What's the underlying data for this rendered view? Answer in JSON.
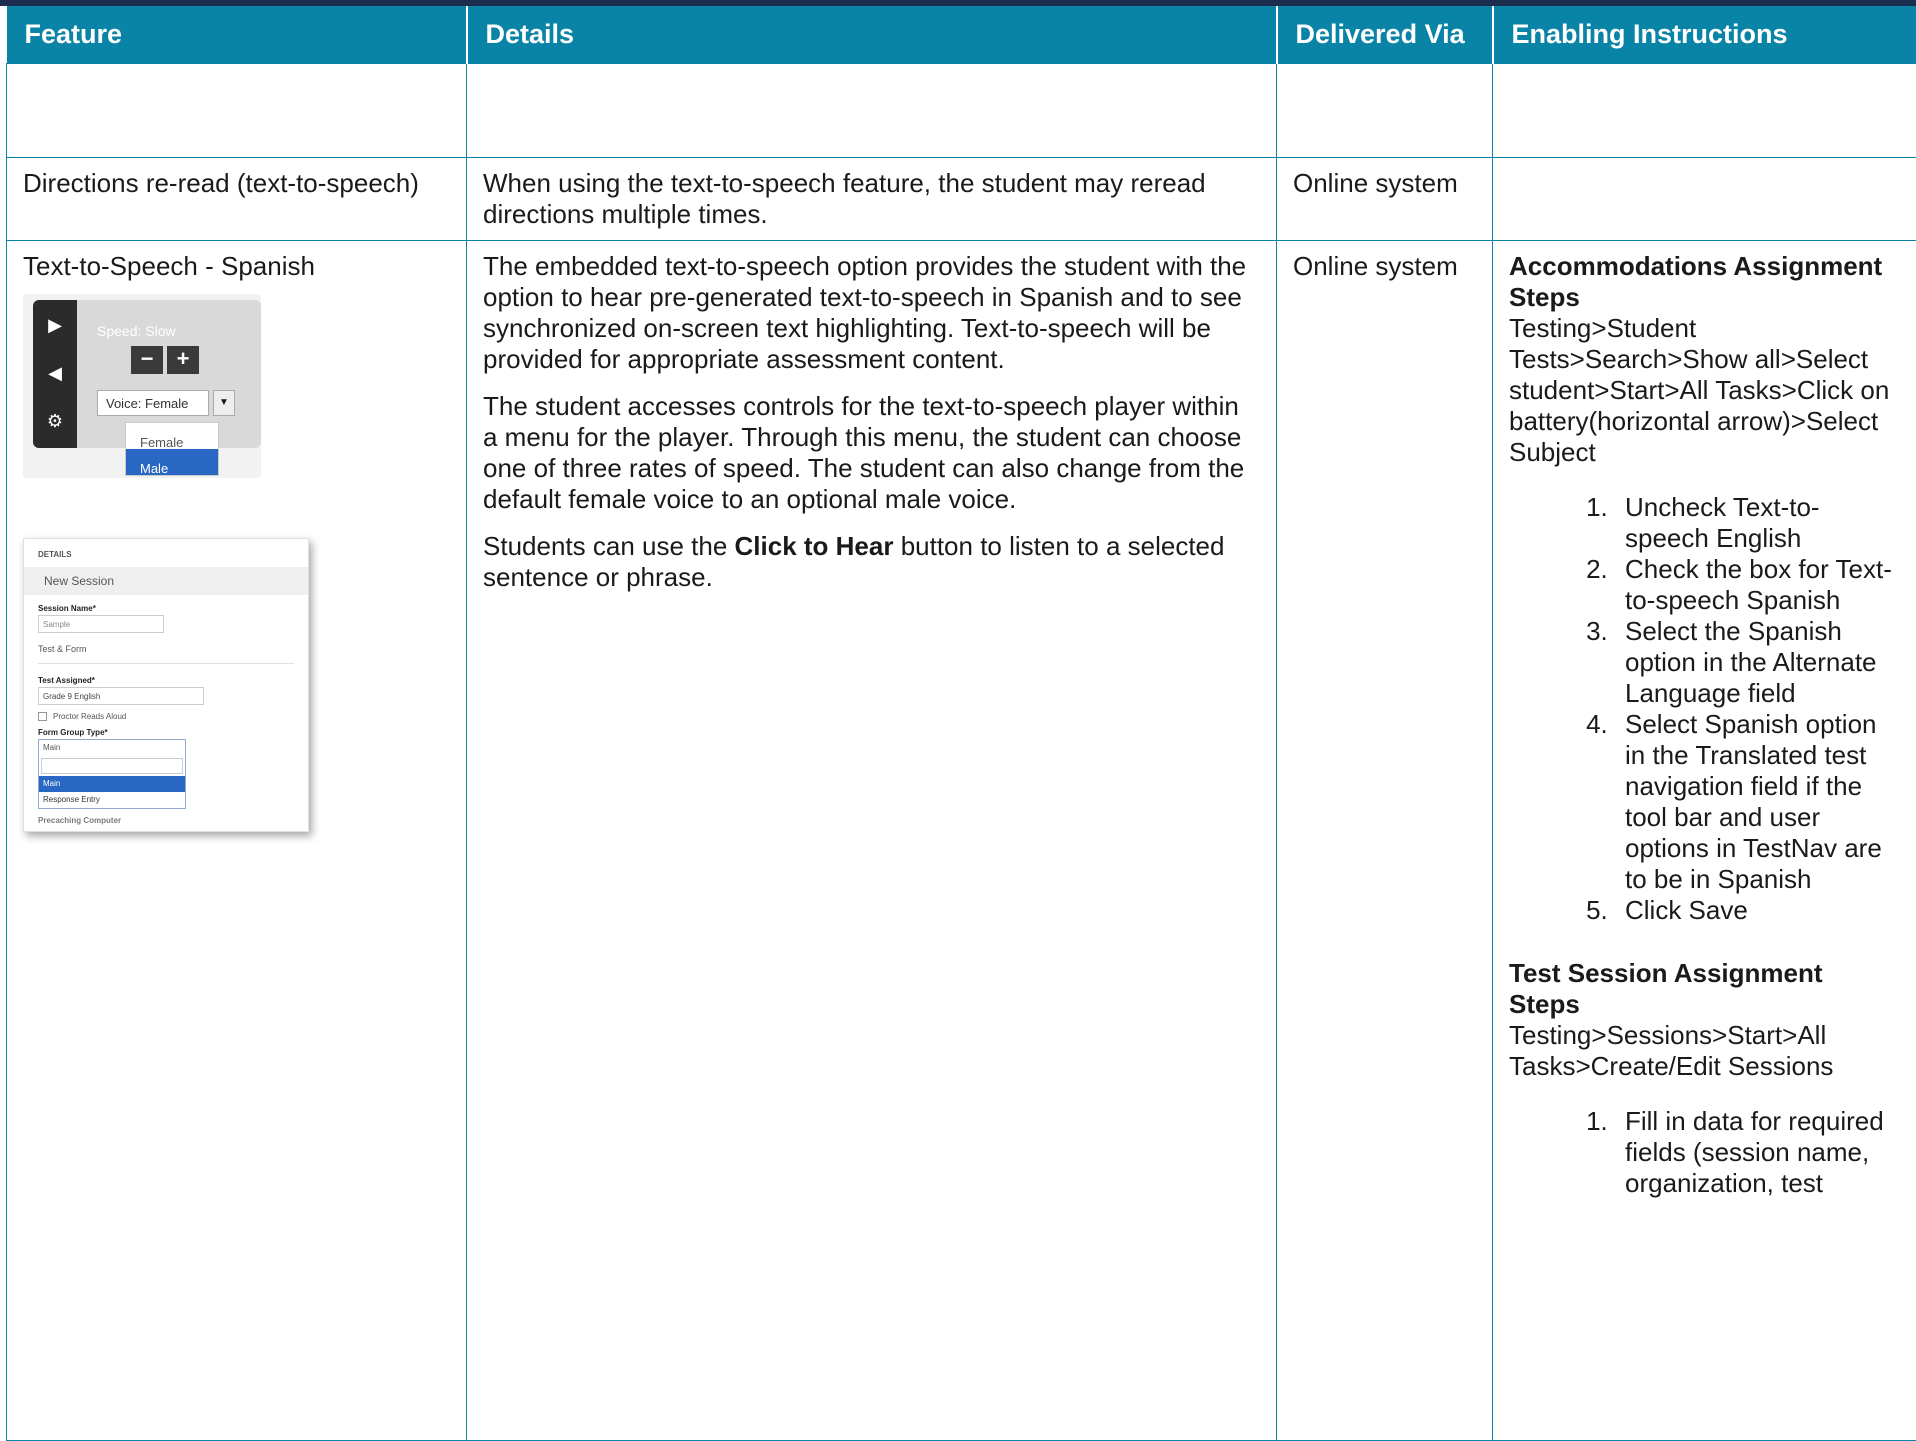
{
  "header": {
    "feature": "Feature",
    "details": "Details",
    "delivered_via": "Delivered Via",
    "enabling_instructions": "Enabling Instructions"
  },
  "rows": [
    {
      "feature": "Directions re-read (text-to-speech)",
      "details": "When using the text-to-speech feature, the student may reread directions multiple times.",
      "delivered_via": "Online system"
    },
    {
      "feature": "Text-to-Speech - Spanish",
      "details_p1": "The embedded text-to-speech option provides the student with the option to hear pre-generated text-to-speech in Spanish and to see synchronized on-screen text highlighting. Text-to-speech will be provided for appropriate assessment content.",
      "details_p2": "The student accesses controls for the text-to-speech player within a menu for the player. Through this menu, the student can choose one of three rates of speed. The student can also change from the default female voice to an optional male voice.",
      "details_p3_before": "Students can use the ",
      "details_p3_bold": "Click to Hear",
      "details_p3_after": " button to listen to a selected sentence or phrase.",
      "delivered_via": "Online system",
      "instructions": {
        "acc_heading": "Accommodations Assignment Steps",
        "acc_path": "Testing>Student Tests>Search>Show all>Select student>Start>All Tasks>Click on battery(horizontal arrow)>Select Subject",
        "acc_steps": [
          "Uncheck Text-to-speech English",
          "Check the box for Text-to-speech Spanish",
          "Select the Spanish option in the Alternate Language field",
          "Select Spanish option in the Translated test navigation field if the tool bar and user options in TestNav are to be in Spanish",
          "Click Save"
        ],
        "session_heading": "Test Session Assignment Steps",
        "session_path": "Testing>Sessions>Start>All Tasks>Create/Edit Sessions",
        "session_steps": [
          "Fill in data for required fields (session name, organization, test"
        ]
      },
      "tts_player": {
        "speed": "Speed: Slow",
        "minus": "−",
        "plus": "+",
        "voice": "Voice: Female",
        "options": [
          "Female",
          "Male"
        ]
      },
      "session_form": {
        "details": "DETAILS",
        "title": "New Session",
        "session_name_label": "Session Name*",
        "session_name_value": "Sample",
        "test_form": "Test & Form",
        "test_assigned_label": "Test Assigned*",
        "test_assigned_value": "Grade 9 English",
        "proctor_reads": "Proctor Reads Aloud",
        "form_group_label": "Form Group Type*",
        "form_group_value": "Main",
        "options": [
          "Main",
          "Response Entry"
        ],
        "cut_label": "Precaching Computer"
      }
    }
  ]
}
